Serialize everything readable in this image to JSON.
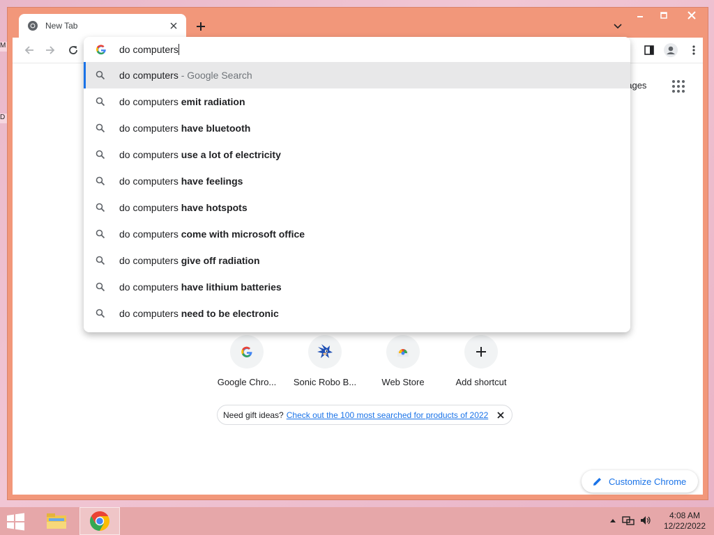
{
  "window": {
    "controls": [
      "minimize",
      "maximize",
      "close"
    ]
  },
  "tab": {
    "title": "New Tab",
    "favicon": "chrome-icon"
  },
  "omnibox": {
    "query": "do computers",
    "suggestions": [
      {
        "prefix": "do computers",
        "sep": " - ",
        "rest": "Google Search",
        "bold": false
      },
      {
        "prefix": "do computers ",
        "rest": "emit radiation",
        "bold": true
      },
      {
        "prefix": "do computers ",
        "rest": "have bluetooth",
        "bold": true
      },
      {
        "prefix": "do computers ",
        "rest": "use a lot of electricity",
        "bold": true
      },
      {
        "prefix": "do computers ",
        "rest": "have feelings",
        "bold": true
      },
      {
        "prefix": "do computers ",
        "rest": "have hotspots",
        "bold": true
      },
      {
        "prefix": "do computers ",
        "rest": "come with microsoft office",
        "bold": true
      },
      {
        "prefix": "do computers ",
        "rest": "give off radiation",
        "bold": true
      },
      {
        "prefix": "do computers ",
        "rest": "have lithium batteries",
        "bold": true
      },
      {
        "prefix": "do computers ",
        "rest": "need to be electronic",
        "bold": true
      }
    ]
  },
  "ntp": {
    "images_link": "nages",
    "shortcuts": [
      {
        "label": "Google Chro...",
        "icon": "google-icon"
      },
      {
        "label": "Sonic Robo B...",
        "icon": "sonic-icon"
      },
      {
        "label": "Web Store",
        "icon": "webstore-icon"
      },
      {
        "label": "Add shortcut",
        "icon": "plus-icon"
      }
    ],
    "promo": {
      "text": "Need gift ideas?",
      "link": "Check out the 100 most searched for products of 2022"
    },
    "customize_label": "Customize Chrome"
  },
  "desktop": {
    "edge_letters": [
      "M",
      "D"
    ]
  },
  "taskbar": {
    "apps": [
      "file-explorer-icon",
      "chrome-icon"
    ],
    "clock": {
      "time": "4:08 AM",
      "date": "12/22/2022"
    }
  },
  "colors": {
    "window_frame": "#f2977a",
    "accent": "#1a73e8",
    "taskbar": "#e6a7a9"
  }
}
